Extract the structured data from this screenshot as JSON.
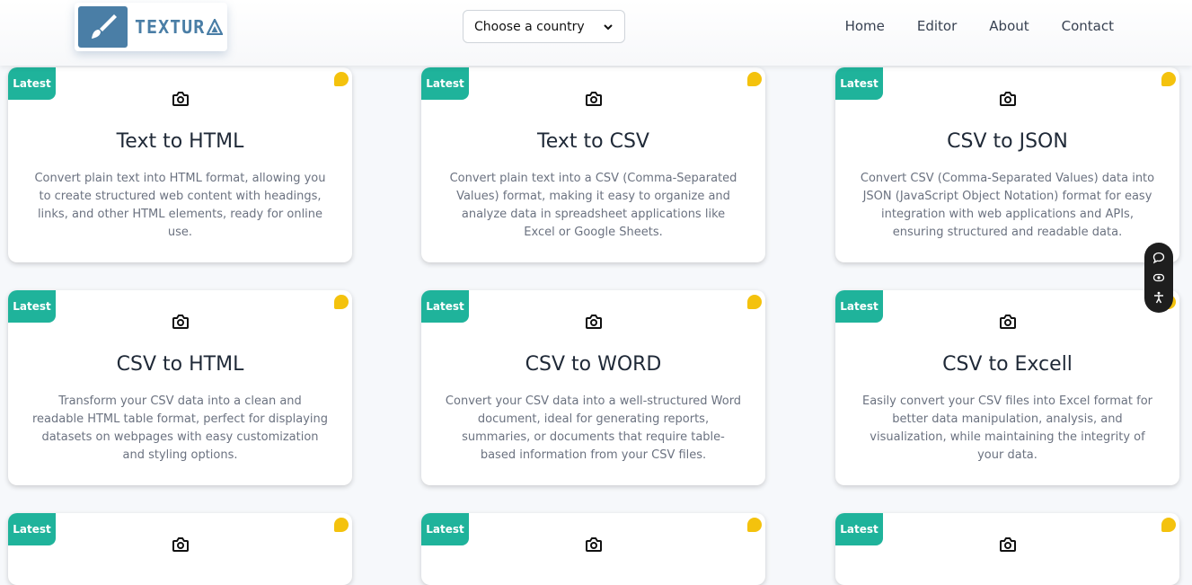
{
  "header": {
    "logo_text": "TEXTUR",
    "country_select": {
      "value": "Choose a country"
    },
    "nav": [
      "Home",
      "Editor",
      "About",
      "Contact"
    ]
  },
  "colors": {
    "badge": "#1fb39b",
    "dot": "#f4c20d",
    "brand": "#4a7ea6"
  },
  "cards": [
    {
      "badge": "Latest",
      "title": "Text to HTML",
      "desc": "Convert plain text into HTML format, allowing you to create structured web content with headings, links, and other HTML elements, ready for online use."
    },
    {
      "badge": "Latest",
      "title": "Text to CSV",
      "desc": "Convert plain text into a CSV (Comma-Separated Values) format, making it easy to organize and analyze data in spreadsheet applications like Excel or Google Sheets."
    },
    {
      "badge": "Latest",
      "title": "CSV to JSON",
      "desc": "Convert CSV (Comma-Separated Values) data into JSON (JavaScript Object Notation) format for easy integration with web applications and APIs, ensuring structured and readable data."
    },
    {
      "badge": "Latest",
      "title": "CSV to HTML",
      "desc": "Transform your CSV data into a clean and readable HTML table format, perfect for displaying datasets on webpages with easy customization and styling options."
    },
    {
      "badge": "Latest",
      "title": "CSV to WORD",
      "desc": "Convert your CSV data into a well-structured Word document, ideal for generating reports, summaries, or documents that require table-based information from your CSV files."
    },
    {
      "badge": "Latest",
      "title": "CSV to Excell",
      "desc": "Easily convert your CSV files into Excel format for better data manipulation, analysis, and visualization, while maintaining the integrity of your data."
    },
    {
      "badge": "Latest"
    },
    {
      "badge": "Latest"
    },
    {
      "badge": "Latest"
    }
  ],
  "widget_icons": [
    "chat-icon",
    "eye-icon",
    "accessibility-icon"
  ]
}
